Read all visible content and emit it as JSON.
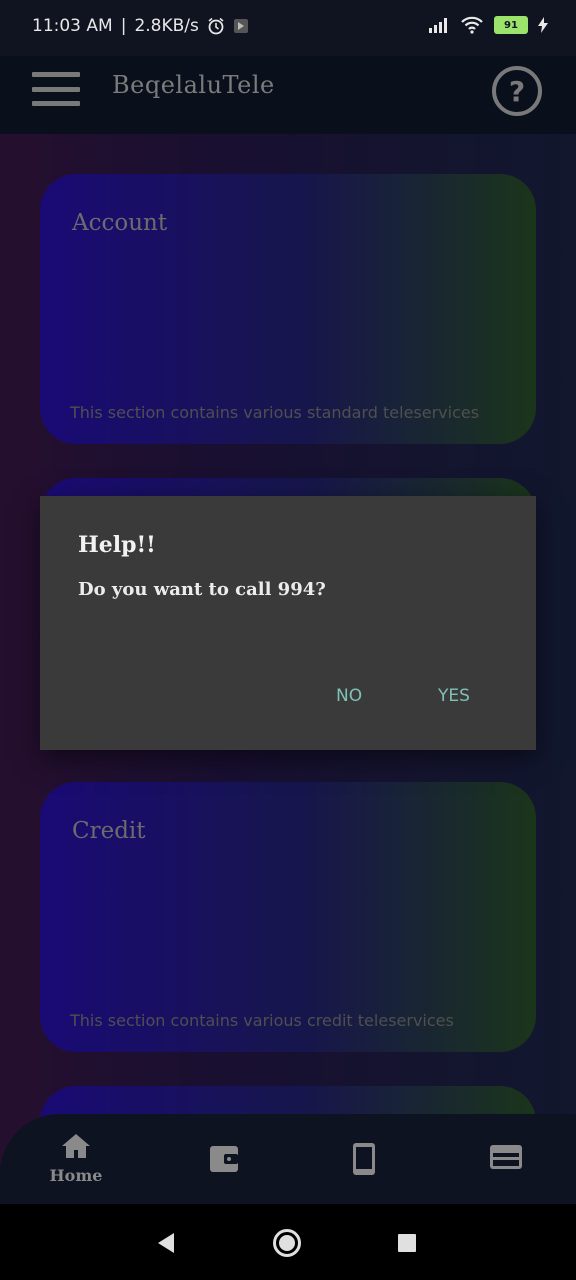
{
  "status_bar": {
    "time": "11:03 AM",
    "speed": "2.8KB/s",
    "battery": "91"
  },
  "app_bar": {
    "title": "BeqelaluTele"
  },
  "cards": [
    {
      "title": "Account",
      "description": "This section contains various standard teleservices"
    },
    {
      "title": "Credit",
      "description": "This section contains various credit teleservices"
    }
  ],
  "dialog": {
    "title": "Help!!",
    "message": "Do you want to call 994?",
    "no_label": "NO",
    "yes_label": "YES"
  },
  "bottom_nav": {
    "home_label": "Home"
  },
  "colors": {
    "accent": "#7fc1b7",
    "dialog_bg": "#3a3a3a"
  }
}
